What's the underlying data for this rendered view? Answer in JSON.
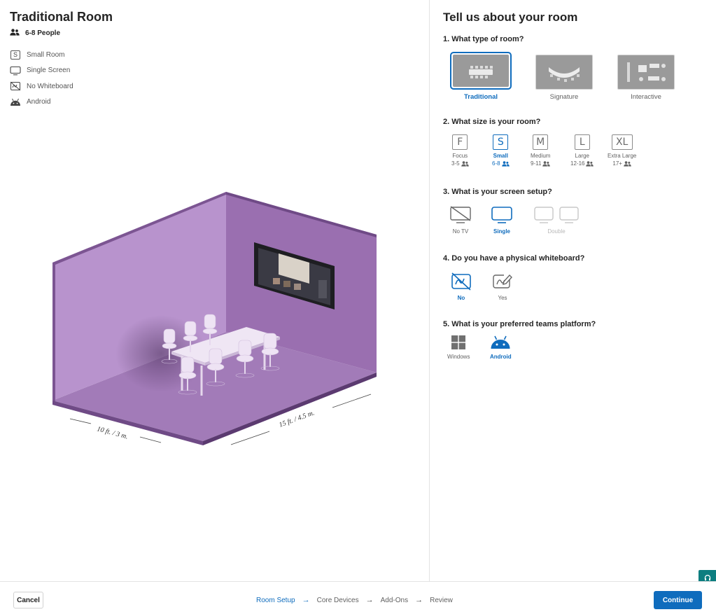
{
  "summary": {
    "title": "Traditional Room",
    "people": "6-8 People",
    "specs": [
      {
        "icon": "size-s-icon",
        "label": "Small Room"
      },
      {
        "icon": "monitor-icon",
        "label": "Single Screen"
      },
      {
        "icon": "no-whiteboard-icon",
        "label": "No Whiteboard"
      },
      {
        "icon": "android-icon",
        "label": "Android"
      }
    ],
    "room_dimensions": {
      "width": "10 ft. / 3 m.",
      "depth": "15 ft. / 4.5 m."
    }
  },
  "form": {
    "title": "Tell us about your room",
    "q1": {
      "label": "1. What type of room?",
      "options": [
        {
          "label": "Traditional",
          "selected": true
        },
        {
          "label": "Signature",
          "selected": false
        },
        {
          "label": "Interactive",
          "selected": false
        }
      ]
    },
    "q2": {
      "label": "2. What size is your room?",
      "options": [
        {
          "letter": "F",
          "label": "Focus",
          "count": "3-5",
          "selected": false
        },
        {
          "letter": "S",
          "label": "Small",
          "count": "6-8",
          "selected": true
        },
        {
          "letter": "M",
          "label": "Medium",
          "count": "9-11",
          "selected": false
        },
        {
          "letter": "L",
          "label": "Large",
          "count": "12-16",
          "selected": false
        },
        {
          "letter": "XL",
          "label": "Extra Large",
          "count": "17+",
          "selected": false
        }
      ]
    },
    "q3": {
      "label": "3. What is your screen setup?",
      "options": [
        {
          "label": "No TV",
          "selected": false
        },
        {
          "label": "Single",
          "selected": true
        },
        {
          "label": "Double",
          "selected": false
        }
      ]
    },
    "q4": {
      "label": "4. Do you have a physical whiteboard?",
      "options": [
        {
          "label": "No",
          "selected": true
        },
        {
          "label": "Yes",
          "selected": false
        }
      ]
    },
    "q5": {
      "label": "5. What is your preferred teams platform?",
      "options": [
        {
          "label": "Windows",
          "selected": false
        },
        {
          "label": "Android",
          "selected": true
        }
      ]
    }
  },
  "footer": {
    "cancel": "Cancel",
    "steps": [
      "Room Setup",
      "Core Devices",
      "Add-Ons",
      "Review"
    ],
    "active_step": "Room Setup",
    "continue": "Continue"
  },
  "colors": {
    "accent": "#0f6cbd",
    "room_wall": "#9a6fb0",
    "room_floor": "#a27bb8",
    "help_teal": "#0d7e80"
  }
}
